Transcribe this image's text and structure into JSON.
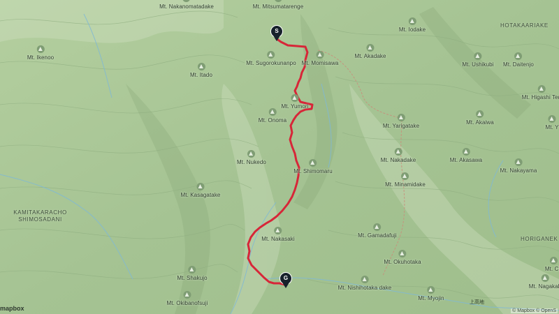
{
  "map": {
    "peaks": [
      {
        "name": "Mt. Nakanomatadake"
      },
      {
        "name": "Mt. Mitsumatarenge"
      },
      {
        "name": "Mt. Iodake"
      },
      {
        "name": "Mt. Ikenoo"
      },
      {
        "name": "Mt. Akadake"
      },
      {
        "name": "Mt. Sugorokunanpo"
      },
      {
        "name": "Mt. Momisawa"
      },
      {
        "name": "Mt. Ushikubi"
      },
      {
        "name": "Mt. Daitenjo"
      },
      {
        "name": "Mt. Itado"
      },
      {
        "name": "Mt. Higashi Ten"
      },
      {
        "name": "Mt. Yumori"
      },
      {
        "name": "Mt. Onoma"
      },
      {
        "name": "Mt. Yarigatake"
      },
      {
        "name": "Mt. Akaiwa"
      },
      {
        "name": "Mt. Y"
      },
      {
        "name": "Mt. Nukedo"
      },
      {
        "name": "Mt. Nakadake"
      },
      {
        "name": "Mt. Akasawa"
      },
      {
        "name": "Mt. Shimomaru"
      },
      {
        "name": "Mt. Nakayama"
      },
      {
        "name": "Mt. Minamidake"
      },
      {
        "name": "Mt. Kasagatake"
      },
      {
        "name": "Mt. Gamadafuji"
      },
      {
        "name": "Mt. Nakasaki"
      },
      {
        "name": "Mt. Okuhotaka"
      },
      {
        "name": "Mt. Ch"
      },
      {
        "name": "Mt. Shakujo"
      },
      {
        "name": "Mt. Nishihotaka dake"
      },
      {
        "name": "Mt. Nagakab"
      },
      {
        "name": "Mt. Okibanofsuji"
      },
      {
        "name": "Mt. Myojin"
      }
    ],
    "areas": [
      {
        "name": "HOTAKAARIAKE"
      },
      {
        "name": "KAMITAKARACHO SHIMOSADANI"
      },
      {
        "name": "HORIGANEK"
      }
    ],
    "start_marker": "S",
    "goal_marker": "G",
    "kanji_label": "上高地",
    "route_color": "#d72638"
  },
  "attribution": "© Mapbox © OpenS",
  "logo": "mapbox"
}
